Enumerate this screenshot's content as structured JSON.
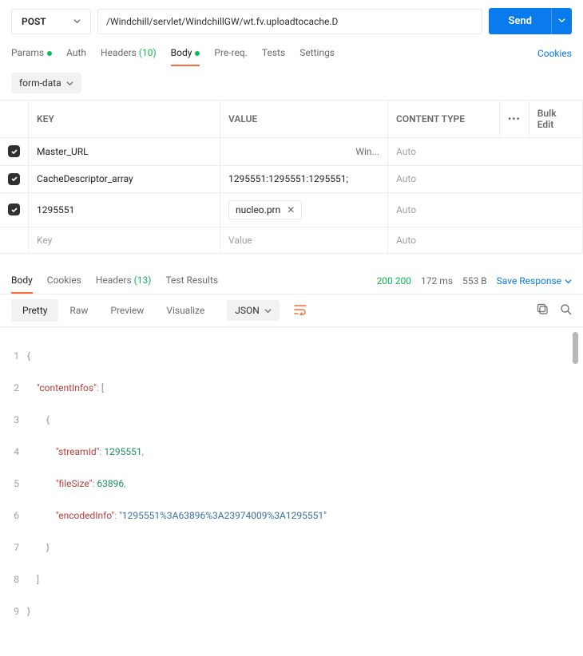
{
  "req": {
    "method": "POST",
    "url": "/Windchill/servlet/WindchillGW/wt.fv.uploadtocache.D",
    "send": "Send"
  },
  "tabs1": {
    "params": "Params",
    "auth": "Auth",
    "headers": "Headers",
    "headers_count": "(10)",
    "body": "Body",
    "prereq": "Pre-req.",
    "tests": "Tests",
    "settings": "Settings",
    "cookies": "Cookies"
  },
  "subtype": "form-data",
  "table": {
    "h_key": "KEY",
    "h_val": "VALUE",
    "h_ct": "CONTENT TYPE",
    "bulk": "Bulk Edit",
    "rows": [
      {
        "k": "Master_URL",
        "v": "",
        "trunc": "Win...",
        "ct": "Auto"
      },
      {
        "k": "CacheDescriptor_array",
        "v": "1295551:1295551:1295551;",
        "ct": "Auto"
      },
      {
        "k": "1295551",
        "file": "nucleo.prn",
        "ct": "Auto"
      }
    ],
    "ph_key": "Key",
    "ph_val": "Value",
    "ph_ct": "Auto"
  },
  "resp": {
    "body": "Body",
    "cookies": "Cookies",
    "headers": "Headers",
    "headers_count": "(13)",
    "tests": "Test Results",
    "status_a": "200",
    "status_b": "200",
    "time": "172 ms",
    "size": "553 B",
    "save": "Save Response"
  },
  "viewbar": {
    "pretty": "Pretty",
    "raw": "Raw",
    "preview": "Preview",
    "visualize": "Visualize",
    "lang": "JSON"
  },
  "code": {
    "l1": "{",
    "l2_k": "\"contentInfos\"",
    "l2_r": ": [",
    "l3": "{",
    "l4_k": "\"streamId\"",
    "l4_v": "1295551",
    "l4_c": ",",
    "l5_k": "\"fileSize\"",
    "l5_v": "63896",
    "l5_c": ",",
    "l6_k": "\"encodedInfo\"",
    "l6_v": "\"1295551%3A63896%3A23974009%3A1295551\"",
    "l7": "}",
    "l8": "]",
    "l9": "}"
  }
}
